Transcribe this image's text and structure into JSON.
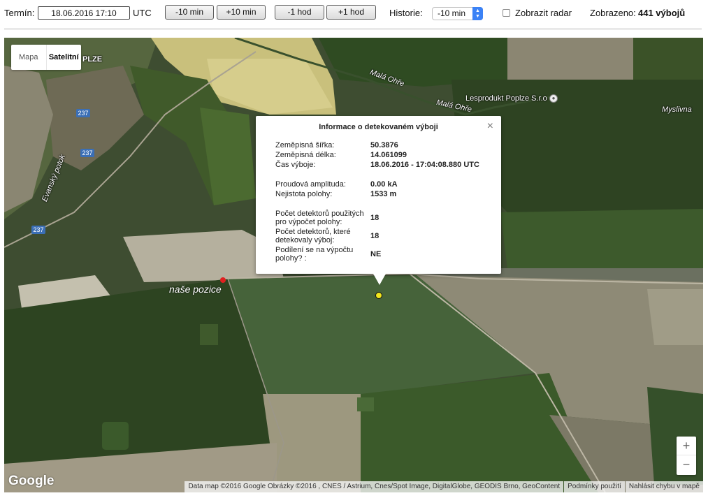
{
  "toolbar": {
    "term_label": "Termín:",
    "term_value": "18.06.2016 17:10",
    "timezone": "UTC",
    "buttons": [
      "-10 min",
      "+10 min",
      "-1 hod",
      "+1 hod"
    ],
    "history_label": "Historie:",
    "history_value": "-10 min",
    "radar_label": "Zobrazit radar",
    "shown_label": "Zobrazeno:",
    "shown_value": "441 výbojů"
  },
  "map": {
    "type_options": {
      "map": "Mapa",
      "satellite": "Satelitní"
    },
    "active_type": "Satelitní",
    "labels": {
      "town": "PLZE",
      "river1": "Malá Ohře",
      "river2": "Malá Ohře",
      "company": "Lesprodukt Poplze S.r.o",
      "village": "Myslivna",
      "stream": "Evanský potok"
    },
    "road_number": "237",
    "our_position_label": "naše pozice",
    "zoom": {
      "in": "+",
      "out": "−"
    },
    "logo": "Google",
    "attribution": {
      "data": "Data map ©2016 Google Obrázky ©2016 , CNES / Astrium, Cnes/Spot Image, DigitalGlobe, GEODIS Brno, GeoContent",
      "terms": "Podmínky použití",
      "report": "Nahlásit chybu v mapě"
    }
  },
  "info_window": {
    "title": "Informace o detekovaném výboji",
    "close": "×",
    "lat_label": "Zeměpisná šířka:",
    "lat_value": "50.3876",
    "lon_label": "Zeměpisná délka:",
    "lon_value": "14.061099",
    "time_label": "Čas výboje:",
    "time_value": "18.06.2016 - 17:04:08.880 UTC",
    "amp_label": "Proudová amplituda:",
    "amp_value": "0.00 kA",
    "unc_label": "Nejistota polohy:",
    "unc_value": "1533 m",
    "det_used_label_1": "Počet detektorů použitých",
    "det_used_label_2": "pro výpočet polohy:",
    "det_used_value": "18",
    "det_detect_label_1": "Počet detektorů, které",
    "det_detect_label_2": "detekovaly výboj:",
    "det_detect_value": "18",
    "share_label_1": "Podílení se na výpočtu",
    "share_label_2": "polohy? :",
    "share_value": "NE"
  },
  "colors": {
    "strike_marker": "#f2e61c",
    "our_position": "#e02020",
    "select_arrow": "#3b82f6"
  }
}
